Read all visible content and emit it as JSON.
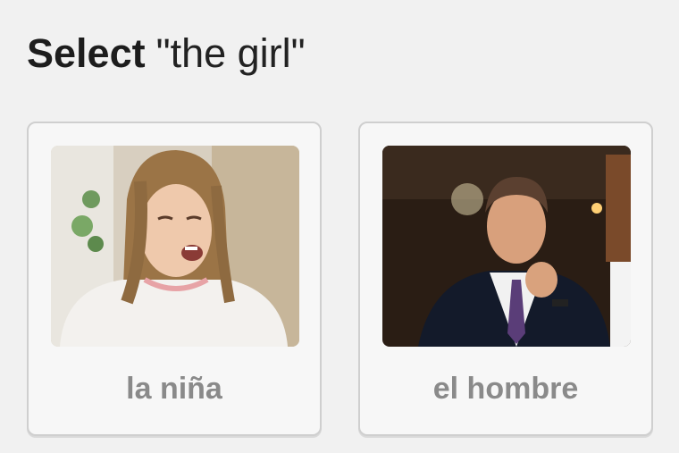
{
  "prompt": {
    "verb": "Select",
    "phrase": "\"the girl\""
  },
  "options": [
    {
      "label": "la niña",
      "image": "girl-photo"
    },
    {
      "label": "el hombre",
      "image": "man-photo"
    }
  ],
  "colors": {
    "background": "#f1f1f1",
    "card_border": "#cfcfcf",
    "label_text": "#8a8a8a",
    "title_text": "#1d1d1d"
  }
}
